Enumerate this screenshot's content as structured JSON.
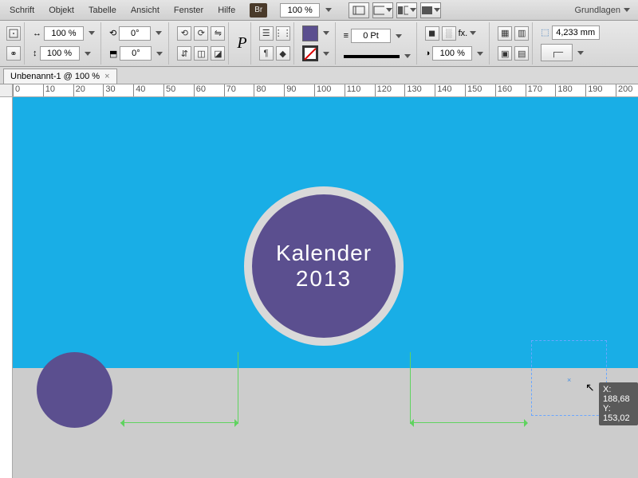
{
  "menu": {
    "items": [
      "Schrift",
      "Objekt",
      "Tabelle",
      "Ansicht",
      "Fenster",
      "Hilfe"
    ]
  },
  "zoom_main": "100 %",
  "workspace_label": "Grundlagen",
  "toolbar": {
    "scale_x": "100 %",
    "scale_y": "100 %",
    "rotate": "0°",
    "shear": "0°",
    "stroke_weight": "0 Pt",
    "opacity": "100 %",
    "measure": "4,233 mm",
    "type_glyph": "P",
    "fx_label": "fx."
  },
  "tab": {
    "title": "Unbenannt-1 @ 100 %",
    "close": "×"
  },
  "ruler_ticks": [
    0,
    10,
    20,
    30,
    40,
    50,
    60,
    70,
    80,
    90,
    100,
    110,
    120,
    130,
    140,
    150,
    160,
    170,
    180,
    190,
    200
  ],
  "canvas": {
    "title_line1": "Kalender",
    "title_line2": "2013"
  },
  "coord_tip": {
    "x": "X: 188,68",
    "y": "Y: 153,02"
  }
}
